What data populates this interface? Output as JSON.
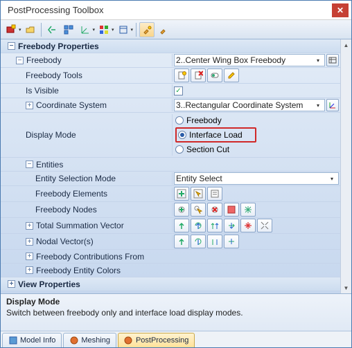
{
  "window": {
    "title": "PostProcessing Toolbox"
  },
  "sections": {
    "freebody_props": "Freebody Properties",
    "view_props": "View Properties",
    "entities": "Entities"
  },
  "rows": {
    "freebody": {
      "label": "Freebody",
      "value": "2..Center Wing Box Freebody"
    },
    "freebody_tools": {
      "label": "Freebody Tools"
    },
    "is_visible": {
      "label": "Is Visible",
      "checked": true
    },
    "coord_sys": {
      "label": "Coordinate System",
      "value": "3..Rectangular Coordinate System"
    },
    "display_mode": {
      "label": "Display Mode",
      "options": {
        "freebody": "Freebody",
        "interface": "Interface Load",
        "section": "Section Cut"
      },
      "selected": "interface"
    },
    "entity_sel_mode": {
      "label": "Entity Selection Mode",
      "value": "Entity Select"
    },
    "freebody_elems": {
      "label": "Freebody Elements"
    },
    "freebody_nodes": {
      "label": "Freebody Nodes"
    },
    "total_sum_vec": {
      "label": "Total Summation Vector"
    },
    "nodal_vec": {
      "label": "Nodal Vector(s)"
    },
    "contrib_from": {
      "label": "Freebody Contributions From"
    },
    "entity_colors": {
      "label": "Freebody Entity Colors"
    }
  },
  "description": {
    "title": "Display Mode",
    "text": "Switch between freebody only and interface load display modes."
  },
  "tabs": {
    "model_info": "Model Info",
    "meshing": "Meshing",
    "postprocessing": "PostProcessing"
  }
}
